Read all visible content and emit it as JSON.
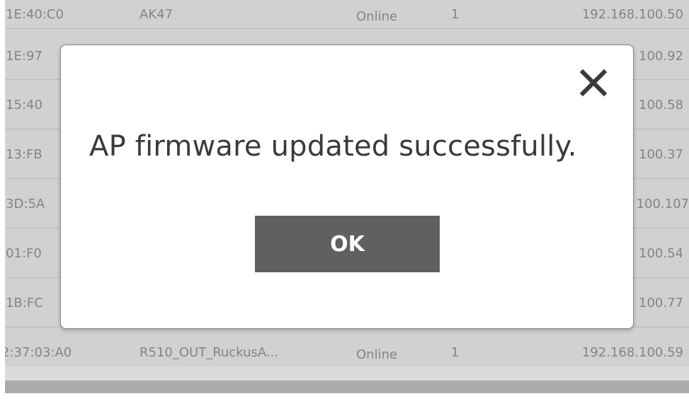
{
  "background_table": {
    "rows": [
      {
        "mac": ":1E:40:C0",
        "name": "AK47",
        "status": "Online",
        "count": "1",
        "ip": "192.168.100.50"
      },
      {
        "mac": ":1E:97",
        "name": "",
        "status": "",
        "count": "",
        "ip": "100.92"
      },
      {
        "mac": ":15:40",
        "name": "",
        "status": "",
        "count": "",
        "ip": "100.58"
      },
      {
        "mac": ":13:FB",
        "name": "",
        "status": "",
        "count": "",
        "ip": "100.37"
      },
      {
        "mac": ":3D:5A",
        "name": "",
        "status": "",
        "count": "",
        "ip": "100.107"
      },
      {
        "mac": ":01:F0",
        "name": "",
        "status": "",
        "count": "",
        "ip": "100.54"
      },
      {
        "mac": ":1B:FC",
        "name": "",
        "status": "",
        "count": "",
        "ip": "100.77"
      },
      {
        "mac": "2:37:03:A0",
        "name": "R510_OUT_RuckusA...",
        "status": "Online",
        "count": "1",
        "ip": "192.168.100.59"
      }
    ]
  },
  "dialog": {
    "message": "AP firmware updated successfully.",
    "ok_label": "OK",
    "close_icon": "close-icon"
  },
  "colors": {
    "ok_button_bg": "#606060",
    "overlay": "rgba(0,0,0,0.14)",
    "message_text": "#3a3a3a"
  }
}
